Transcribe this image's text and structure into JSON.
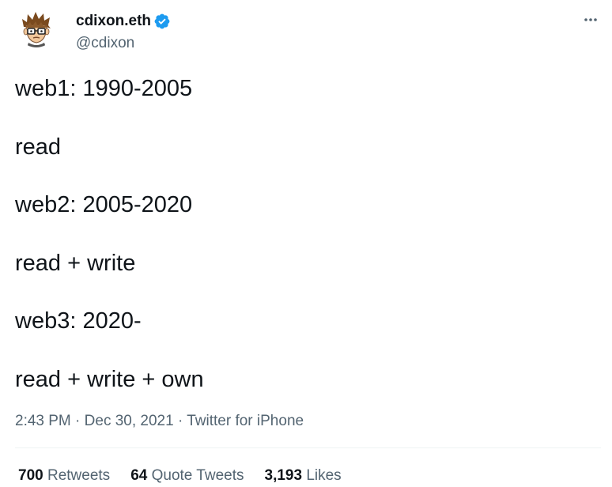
{
  "user": {
    "display_name": "cdixon.eth",
    "handle": "@cdixon",
    "verified": true,
    "verified_color": "#1d9bf0"
  },
  "tweet": {
    "lines": [
      "web1: 1990-2005",
      "read",
      "web2: 2005-2020",
      "read + write",
      "web3: 2020-",
      "read + write + own"
    ],
    "time": "2:43 PM",
    "separator": "·",
    "date": "Dec 30, 2021",
    "source": "Twitter for iPhone"
  },
  "stats": {
    "retweets": {
      "count": "700",
      "label": "Retweets"
    },
    "quote_tweets": {
      "count": "64",
      "label": "Quote Tweets"
    },
    "likes": {
      "count": "3,193",
      "label": "Likes"
    }
  },
  "icons": {
    "more": "more-horizontal-icon",
    "verified": "verified-badge-icon"
  }
}
